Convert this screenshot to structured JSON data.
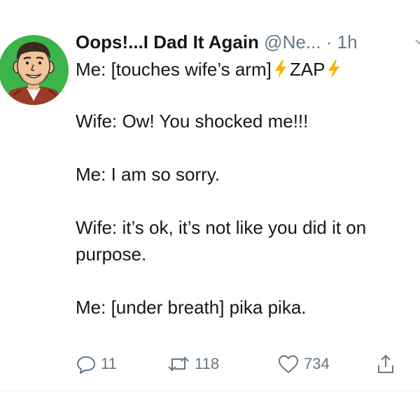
{
  "tweet": {
    "display_name": "Oops!...I Dad It Again",
    "handle": "@Ne...",
    "separator": "·",
    "time": "1h",
    "body": {
      "line1_prefix": "Me: [touches wife’s arm]",
      "line1_word": "ZAP",
      "paragraphs": [
        "Wife: Ow! You shocked me!!!",
        "Me: I am so sorry.",
        "Wife: it’s ok, it’s not like you did it on purpose.",
        "Me: [under breath] pika pika."
      ]
    },
    "actions": {
      "replies": "11",
      "retweets": "118",
      "likes": "734"
    }
  },
  "icons": {
    "avatar": "cartoon-man-avatar",
    "bolt": "lightning-bolt-emoji",
    "reply": "reply-icon",
    "retweet": "retweet-icon",
    "like": "heart-icon",
    "share": "share-icon",
    "caret": "chevron-down-icon"
  },
  "colors": {
    "avatar_background": "#3bb54a",
    "muted_text": "#657786",
    "bolt": "#f4b400"
  }
}
